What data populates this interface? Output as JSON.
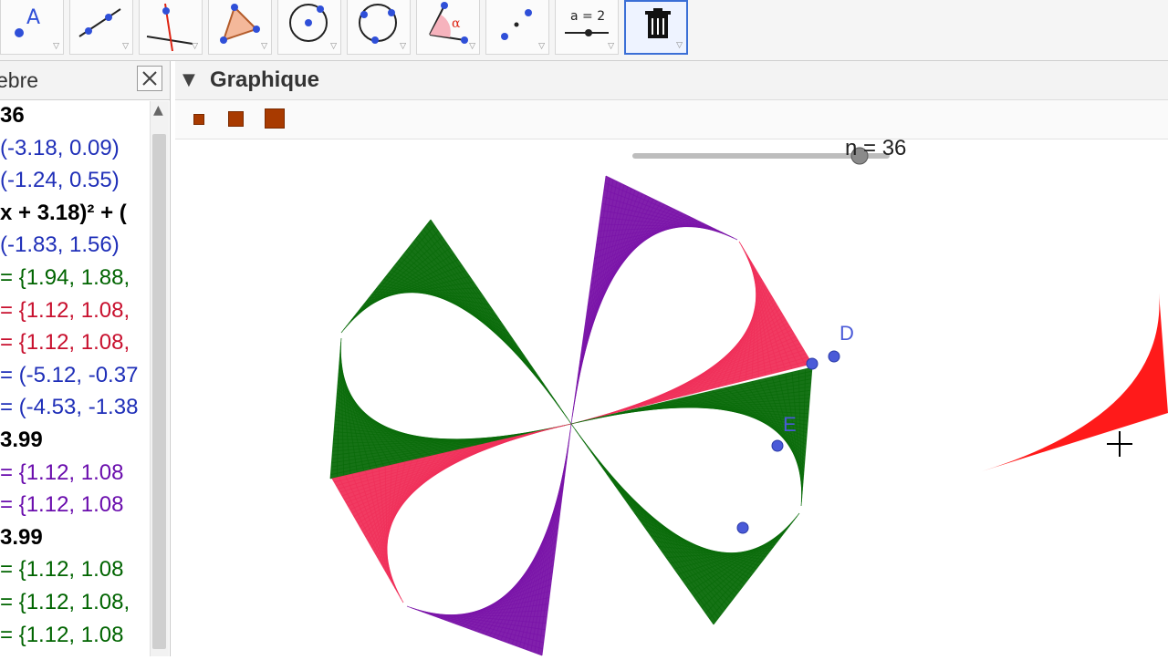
{
  "toolbar": {
    "tools": [
      {
        "icon": "point-label-icon",
        "glyph": "A"
      },
      {
        "icon": "line-icon"
      },
      {
        "icon": "perpendicular-line-icon"
      },
      {
        "icon": "polygon-icon"
      },
      {
        "icon": "circle-center-point-icon"
      },
      {
        "icon": "circle-three-points-icon"
      },
      {
        "icon": "angle-icon",
        "glyph": "α"
      },
      {
        "icon": "reflect-icon"
      },
      {
        "icon": "slider-icon",
        "glyph": "a = 2"
      },
      {
        "icon": "delete-icon"
      }
    ]
  },
  "algebra": {
    "title": "ebre",
    "rows": [
      {
        "text": "36",
        "color": "#000000",
        "bold": true
      },
      {
        "text": "(-3.18, 0.09)",
        "color": "#1f2fb8",
        "bold": false
      },
      {
        "text": "(-1.24, 0.55)",
        "color": "#1f2fb8",
        "bold": false
      },
      {
        "text": "x + 3.18)² + (",
        "color": "#000000",
        "bold": true
      },
      {
        "text": "(-1.83, 1.56)",
        "color": "#1f2fb8",
        "bold": false
      },
      {
        "text": "= {1.94, 1.88,",
        "color": "#006400",
        "bold": false
      },
      {
        "text": "= {1.12, 1.08,",
        "color": "#c8102e",
        "bold": false
      },
      {
        "text": "= {1.12, 1.08,",
        "color": "#c8102e",
        "bold": false
      },
      {
        "text": "= (-5.12, -0.37",
        "color": "#1f2fb8",
        "bold": false
      },
      {
        "text": "= (-4.53, -1.38",
        "color": "#1f2fb8",
        "bold": false
      },
      {
        "text": "3.99",
        "color": "#000000",
        "bold": true
      },
      {
        "text": "= {1.12, 1.08",
        "color": "#6a0dad",
        "bold": false
      },
      {
        "text": "= {1.12, 1.08",
        "color": "#6a0dad",
        "bold": false
      },
      {
        "text": "3.99",
        "color": "#000000",
        "bold": true
      },
      {
        "text": "= {1.12, 1.08",
        "color": "#006400",
        "bold": false
      },
      {
        "text": "= {1.12, 1.08,",
        "color": "#006400",
        "bold": false
      },
      {
        "text": "= {1.12, 1.08",
        "color": "#006400",
        "bold": false
      }
    ]
  },
  "graphics": {
    "title": "Graphique",
    "slider": {
      "label": "n = 36",
      "value": 36
    },
    "points": [
      {
        "label": "D"
      },
      {
        "label": "E"
      }
    ],
    "colors": {
      "green": "#0a6b0a",
      "purple": "#7a14a8",
      "pink": "#f0305a",
      "red": "#ff1a1a",
      "point": "#4a5ad8"
    }
  }
}
